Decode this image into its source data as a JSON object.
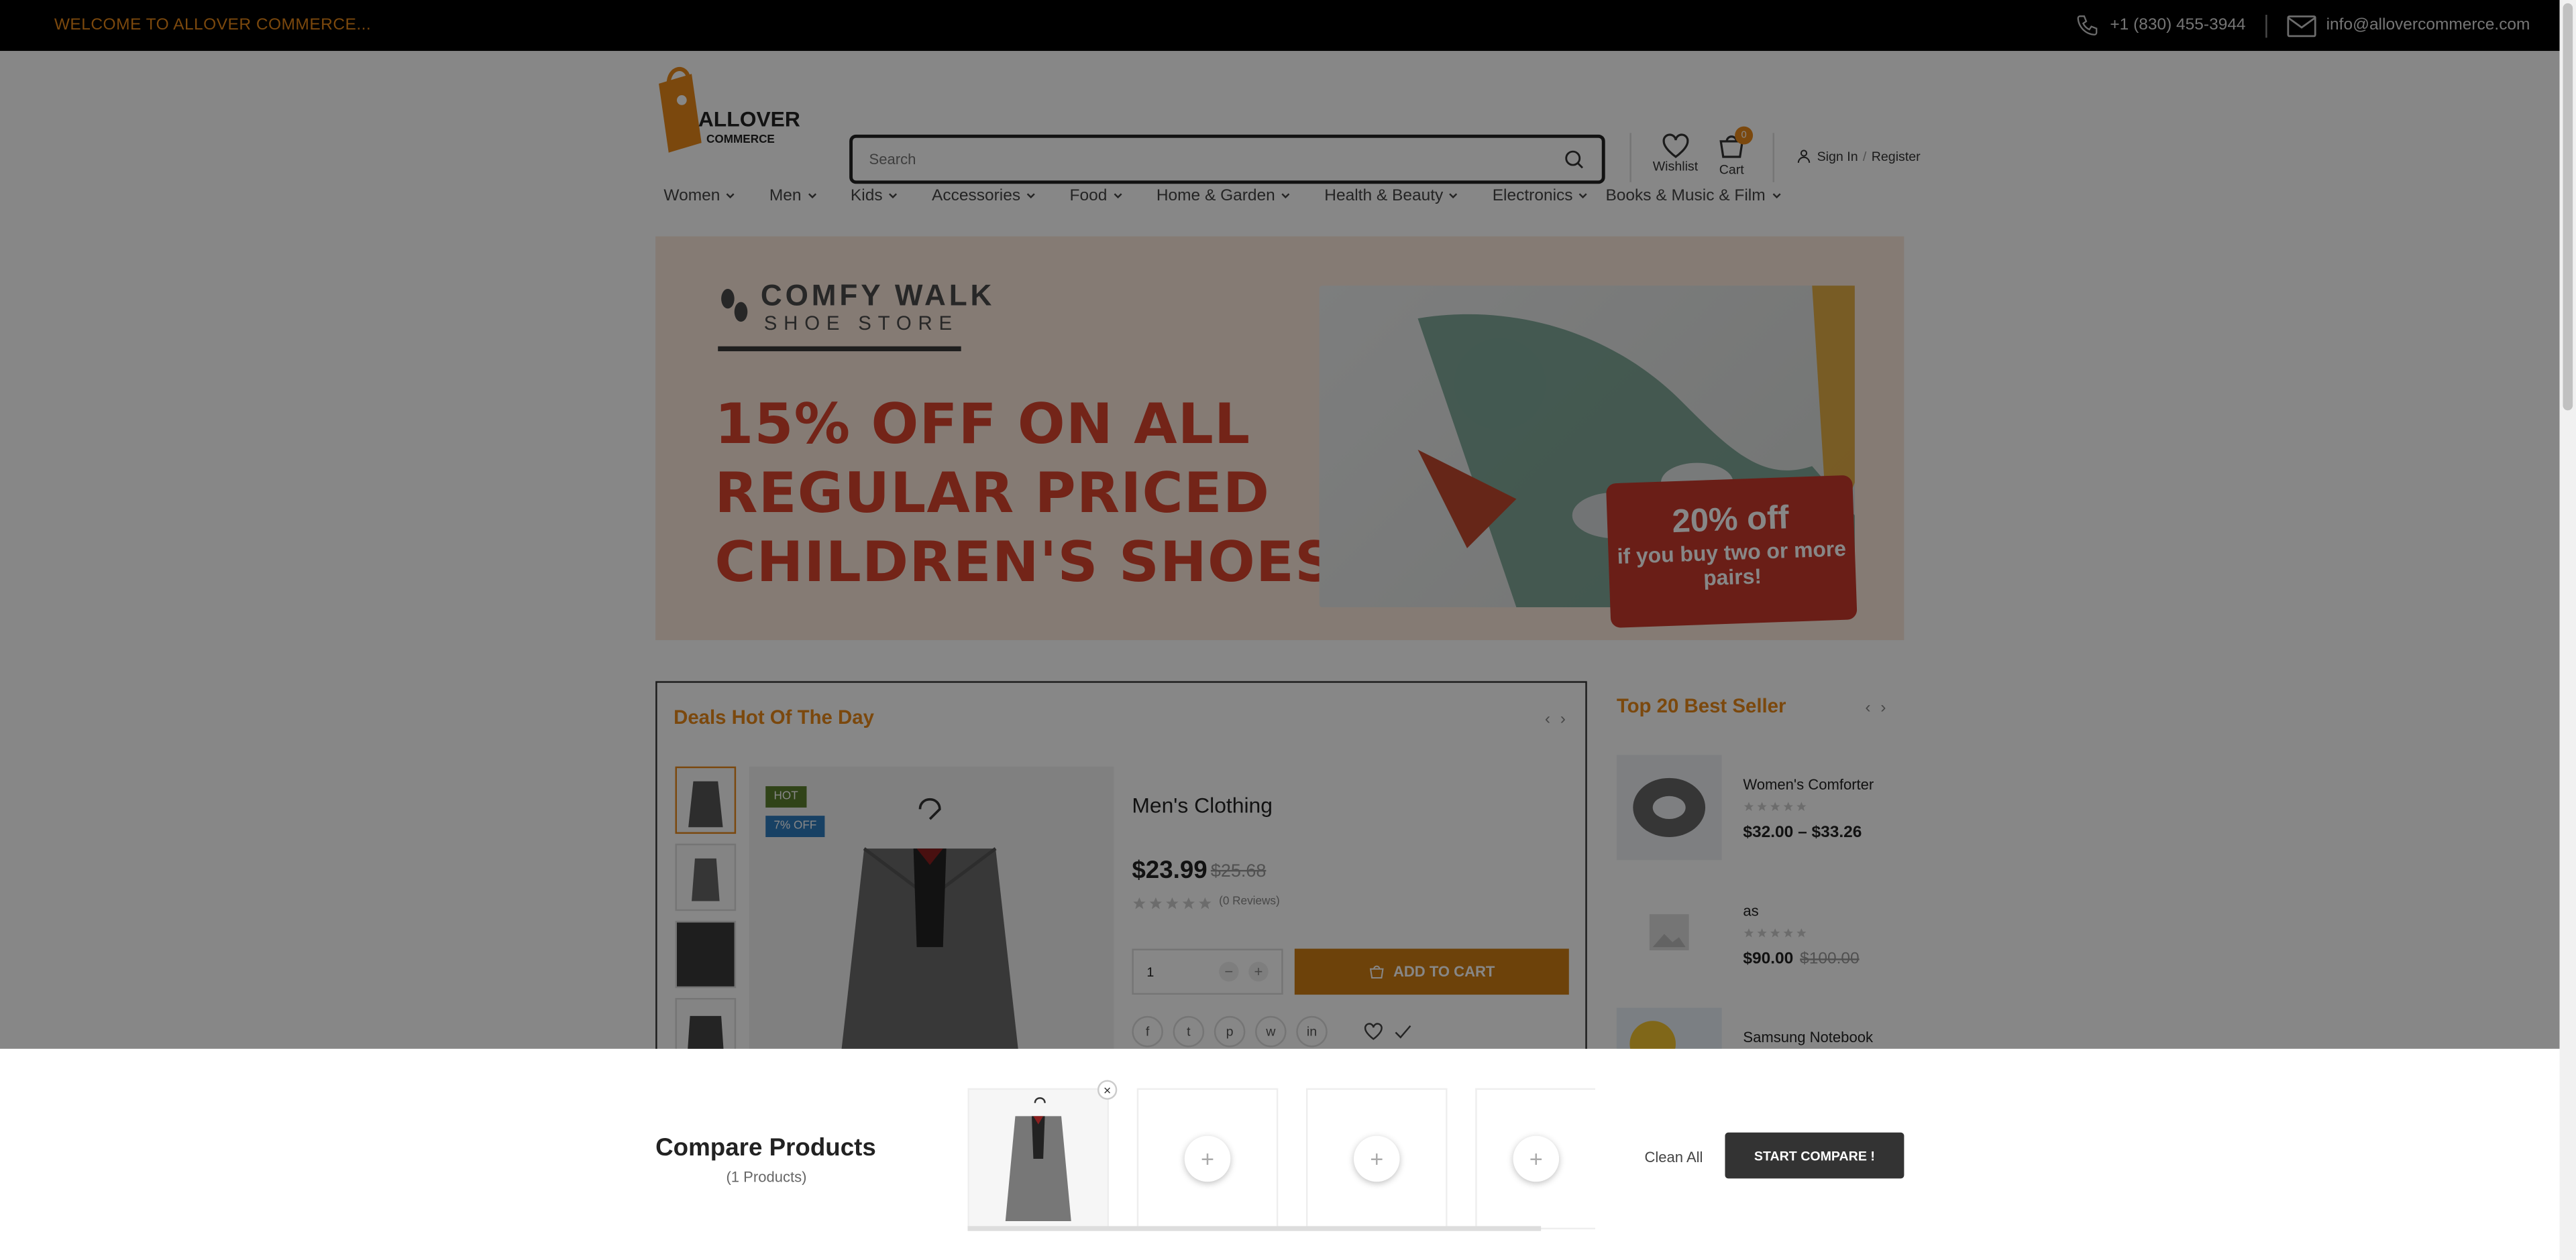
{
  "topbar": {
    "welcome": "WELCOME TO ALLOVER COMMERCE...",
    "phone": "+1 (830) 455-3944",
    "email": "info@allovercommerce.com"
  },
  "header": {
    "logo_text_1": "ALLOVER",
    "logo_text_2": "COMMERCE",
    "search_placeholder": "Search",
    "wishlist_label": "Wishlist",
    "cart_label": "Cart",
    "cart_count": "0",
    "signin_label": "Sign In",
    "slash": "/",
    "register_label": "Register"
  },
  "nav": {
    "items": [
      "Women",
      "Men",
      "Kids",
      "Accessories",
      "Food",
      "Home & Garden",
      "Health & Beauty",
      "Electronics",
      "Books & Music & Film"
    ]
  },
  "banner": {
    "brand_line1": "COMFY WALK",
    "brand_line2": "SHOE STORE",
    "headline": "15% OFF ON ALL REGULAR PRICED CHILDREN'S SHOES",
    "promo_big": "20% off",
    "promo_small": "if you buy two or more pairs!"
  },
  "deals": {
    "title": "Deals Hot Of The Day",
    "badge_hot": "HOT",
    "badge_off": "7% OFF",
    "product_title": "Men's Clothing",
    "price": "$23.99",
    "old_price": "$25.68",
    "reviews": "(0 Reviews)",
    "quantity": "1",
    "add_to_cart": "ADD TO CART"
  },
  "best_seller": {
    "title": "Top 20 Best Seller",
    "items": [
      {
        "name": "Women's Comforter",
        "price": "$32.00 – $33.26",
        "old_price": ""
      },
      {
        "name": "as",
        "price": "$90.00",
        "old_price": "$100.00"
      },
      {
        "name": "Samsung Notebook",
        "price": "",
        "old_price": ""
      }
    ]
  },
  "compare": {
    "title": "Compare Products",
    "count": "(1 Products)",
    "clean_all": "Clean All",
    "start": "START COMPARE !"
  },
  "colors": {
    "accent": "#e8891a",
    "add_to_cart": "#cf7d14",
    "promo": "#c83a2c",
    "hot_badge": "#5b7f2e",
    "off_badge": "#2f7bbd"
  }
}
